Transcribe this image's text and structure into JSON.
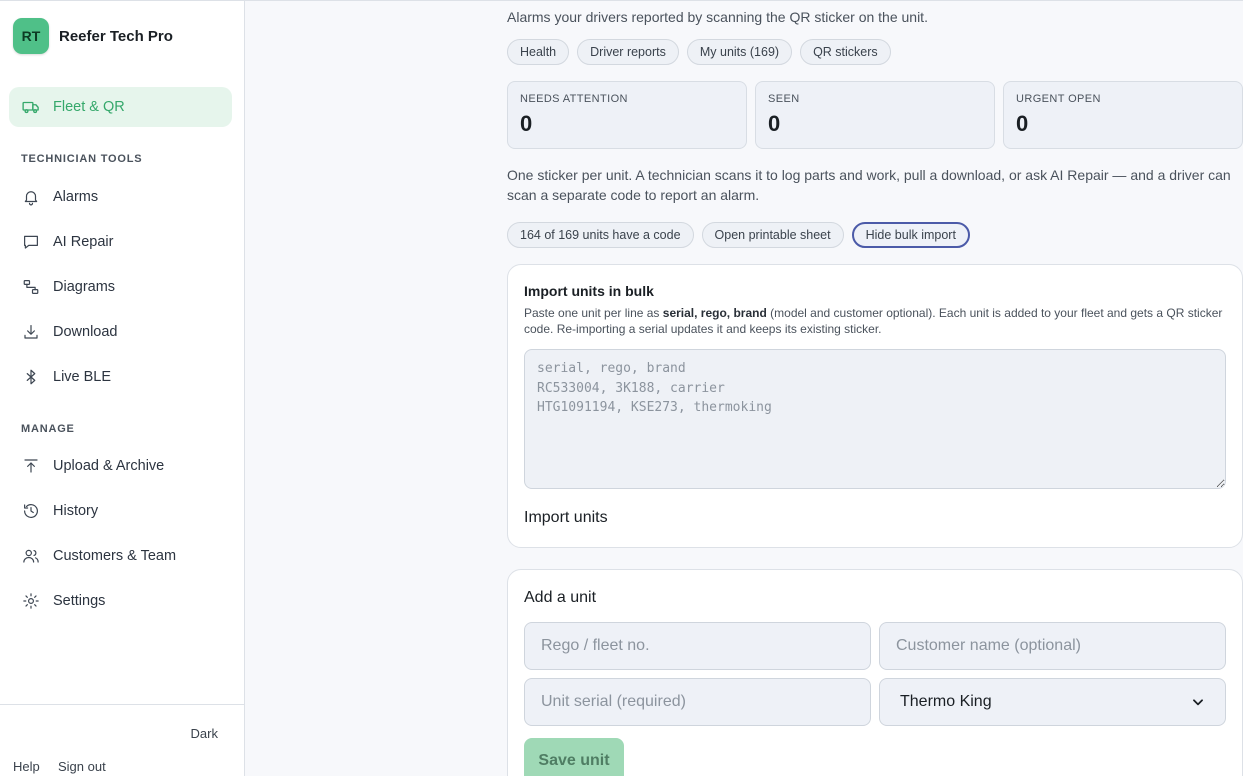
{
  "brand": {
    "initials": "RT",
    "name": "Reefer Tech Pro",
    "accent": "#4fc088"
  },
  "sidebar": {
    "active": {
      "label": "Fleet & QR",
      "icon": "truck-icon"
    },
    "sections": [
      {
        "label": "TECHNICIAN TOOLS",
        "items": [
          {
            "label": "Alarms",
            "icon": "bell-icon"
          },
          {
            "label": "AI Repair",
            "icon": "chat-icon"
          },
          {
            "label": "Diagrams",
            "icon": "diagram-icon"
          },
          {
            "label": "Download",
            "icon": "download-icon"
          },
          {
            "label": "Live BLE",
            "icon": "bluetooth-icon"
          }
        ]
      },
      {
        "label": "MANAGE",
        "items": [
          {
            "label": "Upload & Archive",
            "icon": "upload-icon"
          },
          {
            "label": "History",
            "icon": "history-icon"
          },
          {
            "label": "Customers & Team",
            "icon": "users-icon"
          },
          {
            "label": "Settings",
            "icon": "gear-icon"
          }
        ]
      }
    ],
    "footer": {
      "theme_toggle": "Dark",
      "help": "Help",
      "sign_out": "Sign out"
    }
  },
  "main": {
    "intro": "Alarms your drivers reported by scanning the QR sticker on the unit.",
    "tabs": [
      "Health",
      "Driver reports",
      "My units (169)",
      "QR stickers"
    ],
    "stats": [
      {
        "label": "NEEDS ATTENTION",
        "value": "0"
      },
      {
        "label": "SEEN",
        "value": "0"
      },
      {
        "label": "URGENT OPEN",
        "value": "0"
      }
    ],
    "description": "One sticker per unit. A technician scans it to log parts and work, pull a download, or ask AI Repair — and a driver can scan a separate code to report an alarm.",
    "actions": {
      "coverage": "164 of 169 units have a code",
      "printable": "Open printable sheet",
      "bulk_toggle": "Hide bulk import"
    },
    "bulk_import": {
      "title": "Import units in bulk",
      "help_prefix": "Paste one unit per line as ",
      "help_bold": "serial, rego, brand",
      "help_suffix": " (model and customer optional). Each unit is added to your fleet and gets a QR sticker code. Re-importing a serial updates it and keeps its existing sticker.",
      "placeholder": "serial, rego, brand\nRC533004, 3K188, carrier\nHTG1091194, KSE273, thermoking",
      "button": "Import units"
    },
    "add_unit": {
      "title": "Add a unit",
      "rego_placeholder": "Rego / fleet no.",
      "customer_placeholder": "Customer name (optional)",
      "serial_placeholder": "Unit serial (required)",
      "brand_selected": "Thermo King",
      "save_label": "Save unit"
    }
  }
}
